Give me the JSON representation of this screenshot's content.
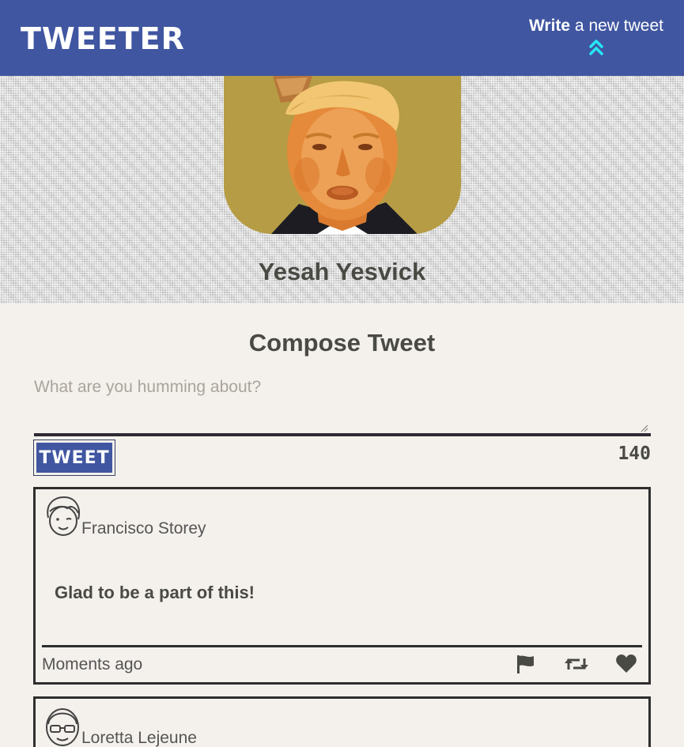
{
  "nav": {
    "brand": "TWEETER",
    "compose_strong": "Write",
    "compose_rest": " a new tweet"
  },
  "profile": {
    "name": "Yesah Yesvick"
  },
  "compose": {
    "title": "Compose Tweet",
    "placeholder": "What are you humming about?",
    "value": "",
    "button_label": "TWEET",
    "counter": "140"
  },
  "tweets": [
    {
      "author": "Francisco Storey",
      "content": "Glad to be a part of this!",
      "time": "Moments ago"
    },
    {
      "author": "Loretta Lejeune"
    }
  ],
  "colors": {
    "nav_bg": "#4056a1",
    "accent_cyan": "#26e6f2",
    "page_bg": "#f4f1ec",
    "text": "#4a4a44"
  },
  "icons": [
    "double-chevron-up-icon",
    "flag-icon",
    "retweet-icon",
    "heart-icon"
  ]
}
